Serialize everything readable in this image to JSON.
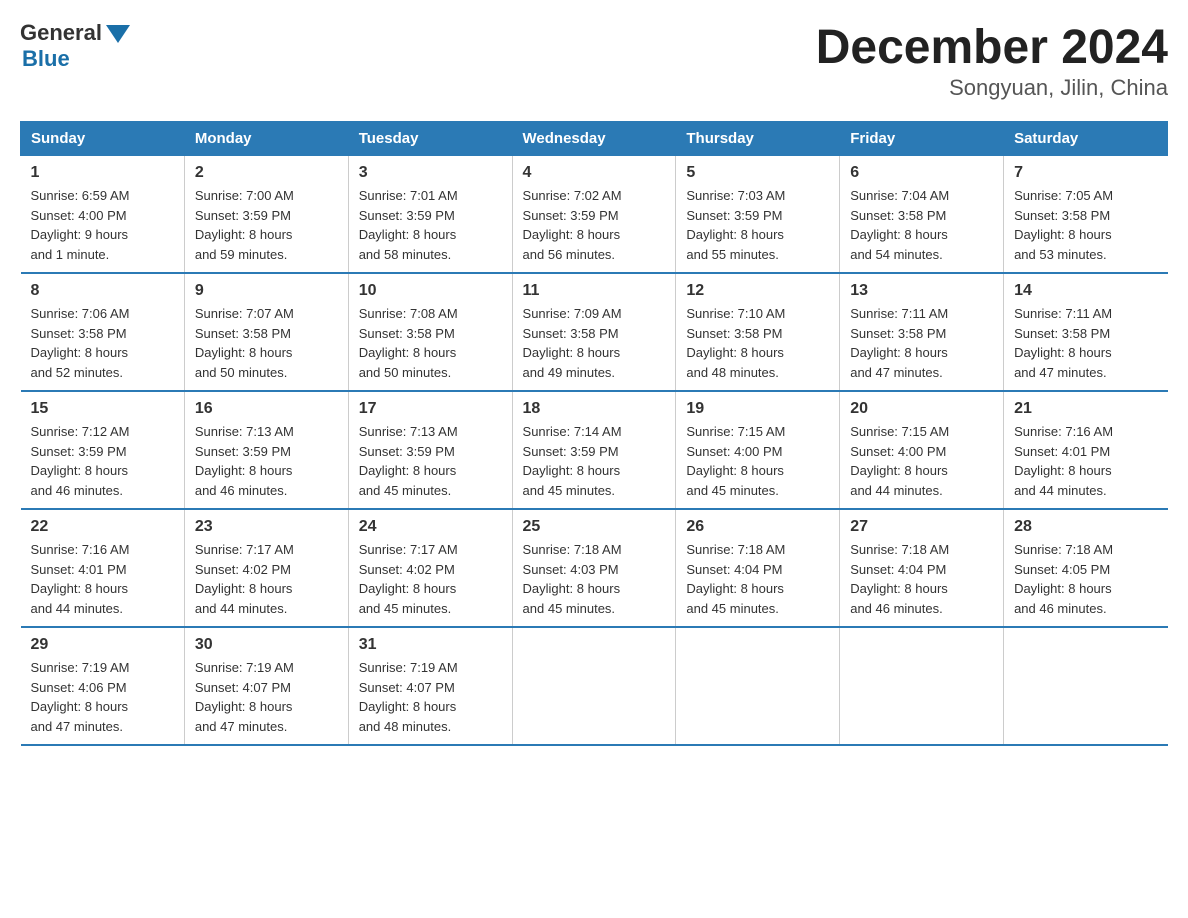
{
  "header": {
    "logo_general": "General",
    "logo_blue": "Blue",
    "month_year": "December 2024",
    "location": "Songyuan, Jilin, China"
  },
  "weekdays": [
    "Sunday",
    "Monday",
    "Tuesday",
    "Wednesday",
    "Thursday",
    "Friday",
    "Saturday"
  ],
  "weeks": [
    [
      {
        "day": "1",
        "sunrise": "6:59 AM",
        "sunset": "4:00 PM",
        "daylight": "9 hours and 1 minute."
      },
      {
        "day": "2",
        "sunrise": "7:00 AM",
        "sunset": "3:59 PM",
        "daylight": "8 hours and 59 minutes."
      },
      {
        "day": "3",
        "sunrise": "7:01 AM",
        "sunset": "3:59 PM",
        "daylight": "8 hours and 58 minutes."
      },
      {
        "day": "4",
        "sunrise": "7:02 AM",
        "sunset": "3:59 PM",
        "daylight": "8 hours and 56 minutes."
      },
      {
        "day": "5",
        "sunrise": "7:03 AM",
        "sunset": "3:59 PM",
        "daylight": "8 hours and 55 minutes."
      },
      {
        "day": "6",
        "sunrise": "7:04 AM",
        "sunset": "3:58 PM",
        "daylight": "8 hours and 54 minutes."
      },
      {
        "day": "7",
        "sunrise": "7:05 AM",
        "sunset": "3:58 PM",
        "daylight": "8 hours and 53 minutes."
      }
    ],
    [
      {
        "day": "8",
        "sunrise": "7:06 AM",
        "sunset": "3:58 PM",
        "daylight": "8 hours and 52 minutes."
      },
      {
        "day": "9",
        "sunrise": "7:07 AM",
        "sunset": "3:58 PM",
        "daylight": "8 hours and 50 minutes."
      },
      {
        "day": "10",
        "sunrise": "7:08 AM",
        "sunset": "3:58 PM",
        "daylight": "8 hours and 50 minutes."
      },
      {
        "day": "11",
        "sunrise": "7:09 AM",
        "sunset": "3:58 PM",
        "daylight": "8 hours and 49 minutes."
      },
      {
        "day": "12",
        "sunrise": "7:10 AM",
        "sunset": "3:58 PM",
        "daylight": "8 hours and 48 minutes."
      },
      {
        "day": "13",
        "sunrise": "7:11 AM",
        "sunset": "3:58 PM",
        "daylight": "8 hours and 47 minutes."
      },
      {
        "day": "14",
        "sunrise": "7:11 AM",
        "sunset": "3:58 PM",
        "daylight": "8 hours and 47 minutes."
      }
    ],
    [
      {
        "day": "15",
        "sunrise": "7:12 AM",
        "sunset": "3:59 PM",
        "daylight": "8 hours and 46 minutes."
      },
      {
        "day": "16",
        "sunrise": "7:13 AM",
        "sunset": "3:59 PM",
        "daylight": "8 hours and 46 minutes."
      },
      {
        "day": "17",
        "sunrise": "7:13 AM",
        "sunset": "3:59 PM",
        "daylight": "8 hours and 45 minutes."
      },
      {
        "day": "18",
        "sunrise": "7:14 AM",
        "sunset": "3:59 PM",
        "daylight": "8 hours and 45 minutes."
      },
      {
        "day": "19",
        "sunrise": "7:15 AM",
        "sunset": "4:00 PM",
        "daylight": "8 hours and 45 minutes."
      },
      {
        "day": "20",
        "sunrise": "7:15 AM",
        "sunset": "4:00 PM",
        "daylight": "8 hours and 44 minutes."
      },
      {
        "day": "21",
        "sunrise": "7:16 AM",
        "sunset": "4:01 PM",
        "daylight": "8 hours and 44 minutes."
      }
    ],
    [
      {
        "day": "22",
        "sunrise": "7:16 AM",
        "sunset": "4:01 PM",
        "daylight": "8 hours and 44 minutes."
      },
      {
        "day": "23",
        "sunrise": "7:17 AM",
        "sunset": "4:02 PM",
        "daylight": "8 hours and 44 minutes."
      },
      {
        "day": "24",
        "sunrise": "7:17 AM",
        "sunset": "4:02 PM",
        "daylight": "8 hours and 45 minutes."
      },
      {
        "day": "25",
        "sunrise": "7:18 AM",
        "sunset": "4:03 PM",
        "daylight": "8 hours and 45 minutes."
      },
      {
        "day": "26",
        "sunrise": "7:18 AM",
        "sunset": "4:04 PM",
        "daylight": "8 hours and 45 minutes."
      },
      {
        "day": "27",
        "sunrise": "7:18 AM",
        "sunset": "4:04 PM",
        "daylight": "8 hours and 46 minutes."
      },
      {
        "day": "28",
        "sunrise": "7:18 AM",
        "sunset": "4:05 PM",
        "daylight": "8 hours and 46 minutes."
      }
    ],
    [
      {
        "day": "29",
        "sunrise": "7:19 AM",
        "sunset": "4:06 PM",
        "daylight": "8 hours and 47 minutes."
      },
      {
        "day": "30",
        "sunrise": "7:19 AM",
        "sunset": "4:07 PM",
        "daylight": "8 hours and 47 minutes."
      },
      {
        "day": "31",
        "sunrise": "7:19 AM",
        "sunset": "4:07 PM",
        "daylight": "8 hours and 48 minutes."
      },
      null,
      null,
      null,
      null
    ]
  ],
  "labels": {
    "sunrise_prefix": "Sunrise: ",
    "sunset_prefix": "Sunset: ",
    "daylight_prefix": "Daylight: "
  }
}
